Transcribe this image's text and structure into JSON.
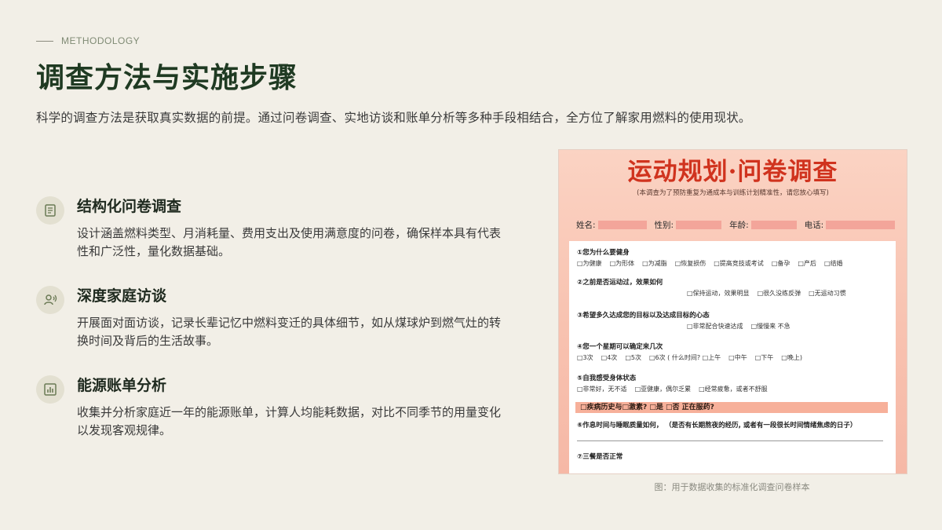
{
  "eyebrow": "METHODOLOGY",
  "title": "调查方法与实施步骤",
  "subtitle": "科学的调查方法是获取真实数据的前提。通过问卷调查、实地访谈和账单分析等多种手段相结合，全方位了解家用燃料的使用现状。",
  "features": [
    {
      "icon": "document-icon",
      "title": "结构化问卷调查",
      "desc": "设计涵盖燃料类型、月消耗量、费用支出及使用满意度的问卷，确保样本具有代表性和广泛性，量化数据基础。"
    },
    {
      "icon": "interview-icon",
      "title": "深度家庭访谈",
      "desc": "开展面对面访谈，记录长辈记忆中燃料变迁的具体细节，如从煤球炉到燃气灶的转换时间及背后的生活故事。"
    },
    {
      "icon": "bar-chart-icon",
      "title": "能源账单分析",
      "desc": "收集并分析家庭近一年的能源账单，计算人均能耗数据，对比不同季节的用量变化以发现客观规律。"
    }
  ],
  "doc": {
    "title": "运动规划·问卷调查",
    "note": "(本调查为了预防重复为通成本与训练计划精准性，请您放心填写)",
    "fields": [
      "姓名:",
      "性别:",
      "年龄:",
      "电话:"
    ],
    "questions": [
      {
        "q": "①您为什么要健身",
        "opts": [
          "□为健康",
          "□为形体",
          "□为减脂",
          "□恢复损伤",
          "□提高竞技或考试",
          "□备孕",
          "□产后",
          "□结婚"
        ]
      },
      {
        "q": "②之前是否运动过，效果如何",
        "opts": [
          "□保持运动，效果明显",
          "□很久没练反弹",
          "□无运动习惯"
        ]
      },
      {
        "q": "③希望多久达成您的目标以及达成目标的心态",
        "opts": [
          "□非常配合快速达成",
          "□慢慢来 不急"
        ]
      },
      {
        "q": "④您一个星期可以确定来几次",
        "opts": [
          "□3次",
          "□4次",
          "□5次",
          "□6次 ( 什么时间? □上午",
          "□中午",
          "□下午",
          "□晚上)"
        ]
      },
      {
        "q": "⑤自我感受身体状态",
        "opts": [
          "□非常好，无不适",
          "□亚健康，偶尔乏累",
          "□经常疲惫，或者不舒服"
        ]
      },
      {
        "q": "⑥作息时间与睡眠质量如何， （是否有长期熬夜的经历, 或者有一段很长时间情绪焦虑的日子）",
        "opts": []
      },
      {
        "q": "⑦三餐是否正常",
        "opts": []
      }
    ],
    "highlight": "□疾病历史与□激素?          □是  □否  正在服药?"
  },
  "caption": "图：用于数据收集的标准化调查问卷样本"
}
